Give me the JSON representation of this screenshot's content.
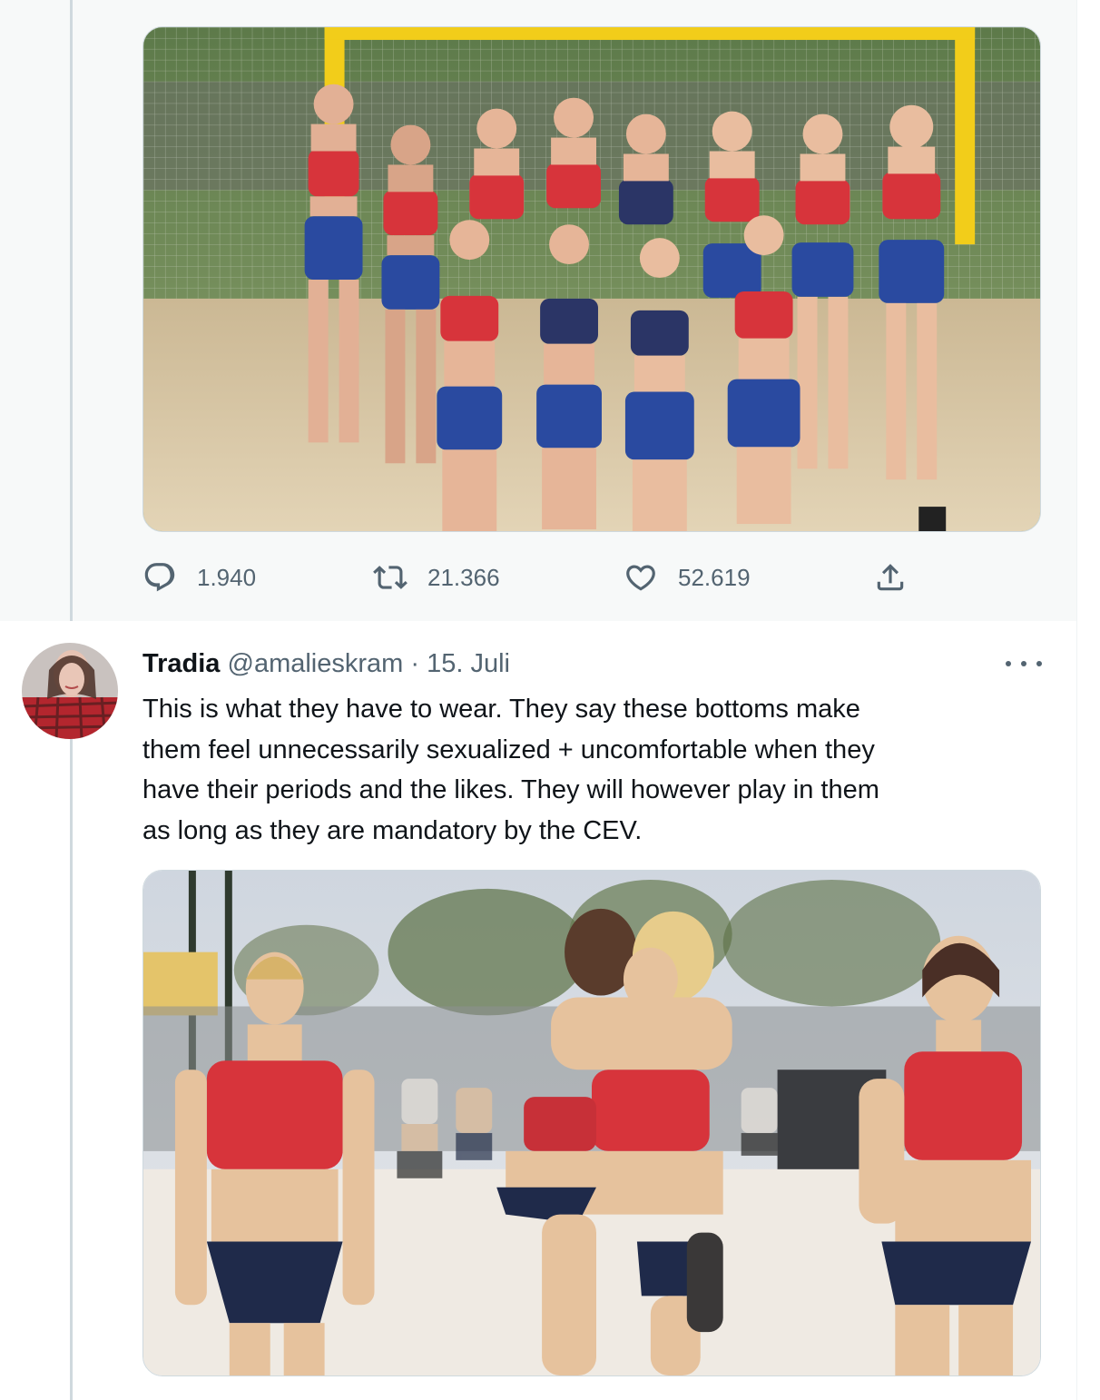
{
  "tweet_1": {
    "photo_alt": "Norway women's beach handball team posing on sand",
    "stats": {
      "replies": "1.940",
      "retweets": "21.366",
      "likes": "52.619"
    },
    "icons": {
      "reply": "reply-icon",
      "retweet": "retweet-icon",
      "like": "heart-icon",
      "share": "share-icon"
    }
  },
  "tweet_2": {
    "author_name": "Tradia",
    "author_handle": "@amalieskram",
    "separator": "·",
    "date": "15. Juli",
    "text": "This is what they have to wear. They say these bottoms make\nthem feel unnecessarily sexualized + uncomfortable when they\nhave their periods and the likes. They will however play in them\nas long as they are mandatory by the CEV.",
    "photo_alt": "Norway beach handball players celebrating on sand",
    "more_icon": "more-options-icon"
  },
  "colors": {
    "text_primary": "#0f1419",
    "text_secondary": "#536471",
    "highlight_bg": "#f7f9f9",
    "jersey_red": "#d7343b",
    "shorts_blue": "#2a4aa0"
  }
}
